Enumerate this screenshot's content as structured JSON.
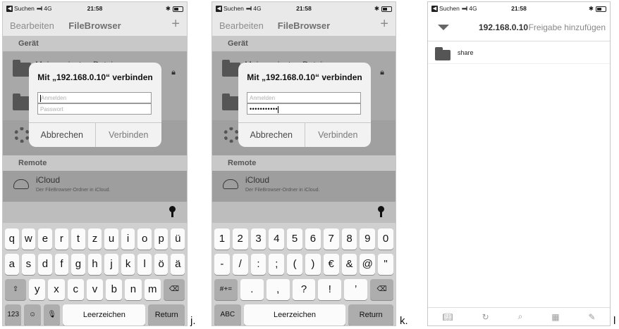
{
  "status": {
    "back_app": "Suchen",
    "network": "4G",
    "time": "21:58",
    "bluetooth": "✱"
  },
  "nav": {
    "edit": "Bearbeiten",
    "title": "FileBrowser",
    "add": "+"
  },
  "sections": {
    "device": "Gerät",
    "remote": "Remote"
  },
  "device_row_partial": "Meine privaten Dateien",
  "dialog": {
    "title": "Mit „192.168.0.10“ verbinden",
    "user_placeholder": "Anmelden",
    "pass_placeholder": "Passwort",
    "password_masked": "•••••••••••",
    "cancel": "Abbrechen",
    "connect": "Verbinden"
  },
  "icloud": {
    "title": "iCloud",
    "subtitle": "Der FileBrowser-Ordner in iCloud."
  },
  "keyboard_letters": {
    "row1": [
      "q",
      "w",
      "e",
      "r",
      "t",
      "z",
      "u",
      "i",
      "o",
      "p",
      "ü"
    ],
    "row2": [
      "a",
      "s",
      "d",
      "f",
      "g",
      "h",
      "j",
      "k",
      "l",
      "ö",
      "ä"
    ],
    "row3": [
      "y",
      "x",
      "c",
      "v",
      "b",
      "n",
      "m"
    ],
    "row4": {
      "numbers": "123",
      "space": "Leerzeichen",
      "return": "Return"
    }
  },
  "keyboard_numbers": {
    "row1": [
      "1",
      "2",
      "3",
      "4",
      "5",
      "6",
      "7",
      "8",
      "9",
      "0"
    ],
    "row2": [
      "-",
      "/",
      ":",
      ";",
      "(",
      ")",
      "€",
      "&",
      "@",
      "\""
    ],
    "row3": [
      ".",
      ",",
      "?",
      "!",
      "’"
    ],
    "row4": {
      "letters": "ABC",
      "space": "Leerzeichen",
      "return": "Return"
    },
    "more": "#+="
  },
  "browser": {
    "host": "192.168.0.10",
    "add_share": "Freigabe hinzufügen",
    "items": [
      "share"
    ]
  },
  "captions": {
    "j": "j.",
    "k": "k.",
    "l": "l"
  }
}
